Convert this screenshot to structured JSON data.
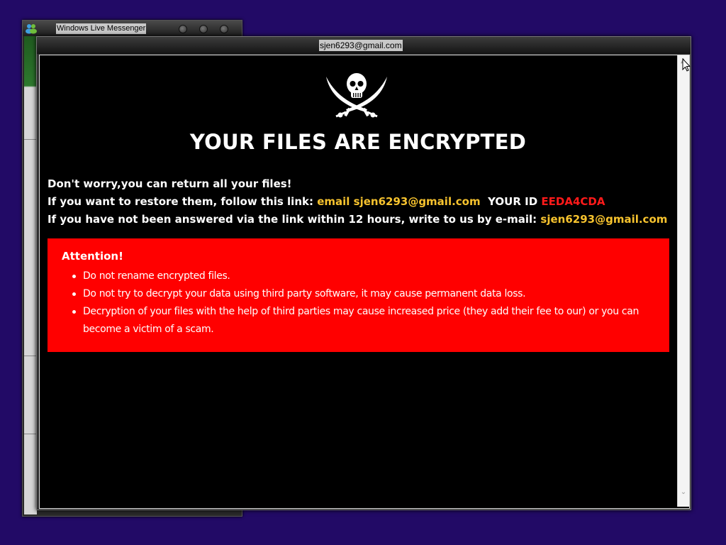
{
  "background_window": {
    "title": "Windows Live Messenger",
    "icon": "messenger-people-icon"
  },
  "ransom_window": {
    "title": "sjen6293@gmail.com",
    "headline": "YOUR FILES ARE ENCRYPTED",
    "logo_icon": "jolly-roger-skull-crossed-swords-icon",
    "line1": "Don't worry,you can return all your files!",
    "line2": {
      "prefix": "If you want to restore them, follow this link:",
      "link_text": "email sjen6293@gmail.com",
      "id_label": "YOUR ID",
      "id_value": "EEDA4CDA"
    },
    "line3": {
      "prefix": "If you have not been answered via the link within 12 hours, write to us by e-mail:",
      "email": "sjen6293@gmail.com"
    },
    "attention": {
      "title": "Attention!",
      "items": [
        "Do not rename encrypted files.",
        "Do not try to decrypt your data using third party software, it may cause permanent data loss.",
        "Decryption of your files with the help of third parties may cause increased price (they add their fee to our) or you can become a victim of a scam."
      ]
    }
  },
  "colors": {
    "desktop": "#220a66",
    "content_bg": "#000000",
    "attention_bg": "#ff0000",
    "highlight_yellow": "#f7c32e",
    "id_red": "#ff1a1a"
  }
}
